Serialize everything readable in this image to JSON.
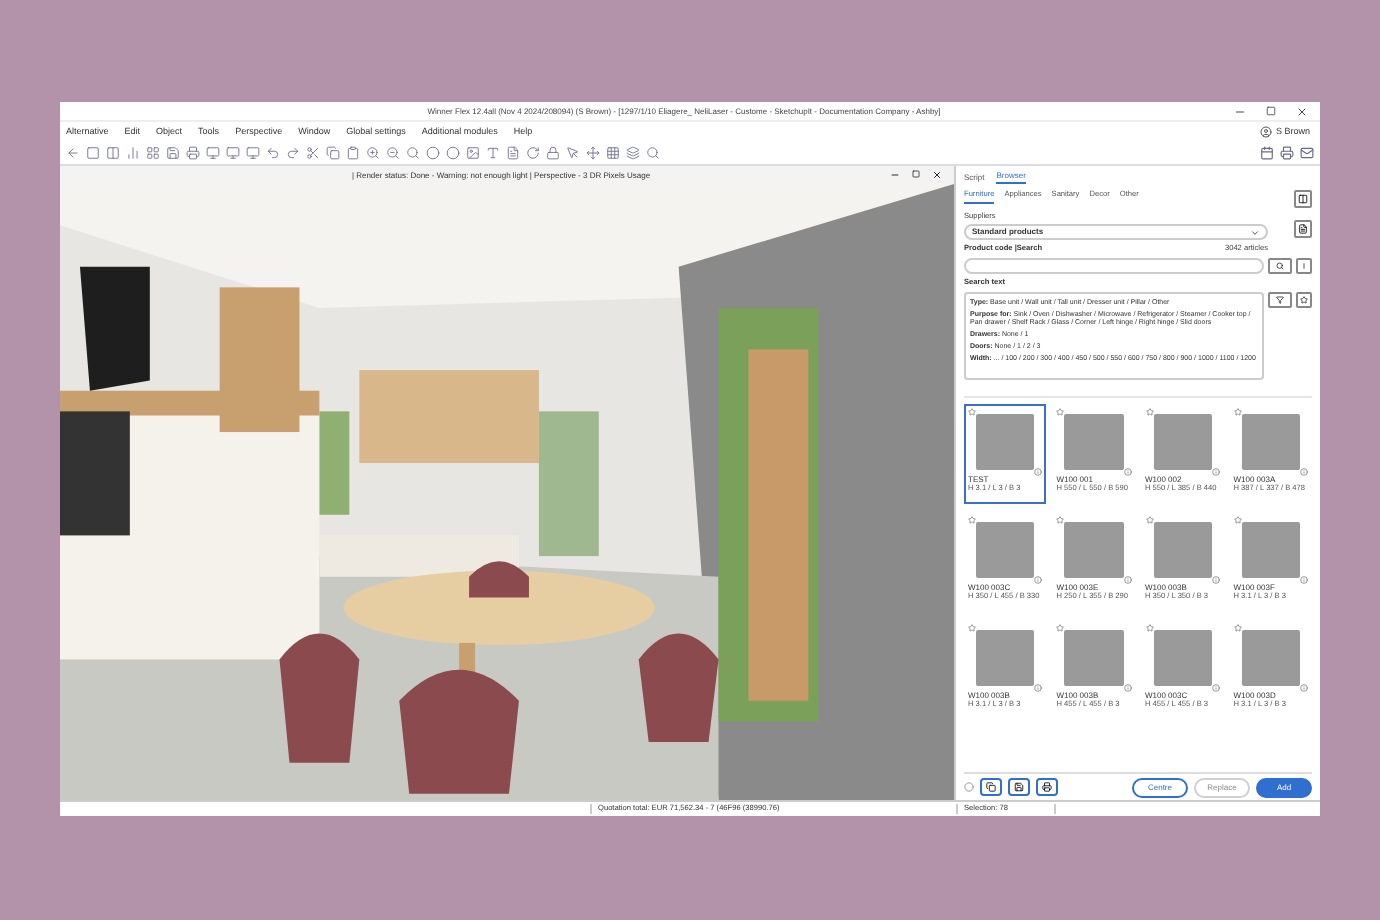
{
  "window": {
    "title": "Winner Flex 12.4all (Nov 4 2024/208094) (S Brown) - [1297/1/10 Eliagere_ NeliLaser - Custome - SketchupIt - Documentation Company - Ashby]"
  },
  "menu": [
    "Alternative",
    "Edit",
    "Object",
    "Tools",
    "Perspective",
    "Window",
    "Global settings",
    "Additional modules",
    "Help"
  ],
  "user": "S Brown",
  "viewport": {
    "status": "| Render status: Done - Warning: not enough light | Perspective - 3 DR Pixels Usage"
  },
  "panel": {
    "tabs": [
      {
        "label": "Script",
        "selected": false
      },
      {
        "label": "Browser",
        "selected": true
      }
    ],
    "subtabs": [
      {
        "label": "Furniture",
        "selected": true
      },
      {
        "label": "Appliances",
        "selected": false
      },
      {
        "label": "Sanitary",
        "selected": false
      },
      {
        "label": "Decor",
        "selected": false
      },
      {
        "label": "Other",
        "selected": false
      }
    ],
    "supplier_label": "Suppliers",
    "supplier": "Standard products",
    "code_label": "Product code |Search",
    "count": "3042 articles",
    "search_label": "Search text",
    "filters": [
      "**Type:** Base unit / Wall unit / Tall unit / Dresser unit / Pillar / Other",
      "**Purpose for:** Sink / Oven / Dishwasher / Microwave / Refrigerator / Steamer / Cooker top / Pan drawer / Shelf Rack / Glass / Corner / Left hinge / Right hinge / Slid doors",
      "**Drawers:** None / 1",
      "**Doors:** None / 1 / 2 / 3",
      "**Width:** ... / 100 / 200 / 300 / 400 / 450 / 500 / 550 / 600 / 750 / 800 / 900 / 1000 / 1100 / 1200"
    ],
    "products": [
      {
        "code": "TEST",
        "dims": "H 3.1 / L 3 / B 3",
        "selected": true
      },
      {
        "code": "W100 001",
        "dims": "H 550 / L 550 / B 590",
        "selected": false
      },
      {
        "code": "W100 002",
        "dims": "H 550 / L 385 / B 440",
        "selected": false
      },
      {
        "code": "W100 003A",
        "dims": "H 387 / L 337 / B 478",
        "selected": false
      },
      {
        "code": "W100 003C",
        "dims": "H 350 / L 455 / B 330",
        "selected": false
      },
      {
        "code": "W100 003E",
        "dims": "H 250 / L 355 / B 290",
        "selected": false
      },
      {
        "code": "W100 003B",
        "dims": "H 350 / L 350 / B 3",
        "selected": false
      },
      {
        "code": "W100 003F",
        "dims": "H 3.1 / L 3 / B 3",
        "selected": false
      },
      {
        "code": "W100 003B",
        "dims": "H 3.1 / L 3 / B 3",
        "selected": false
      },
      {
        "code": "W100 003B",
        "dims": "H 455 / L 455 / B 3",
        "selected": false
      },
      {
        "code": "W100 003C",
        "dims": "H 455 / L 455 / B 3",
        "selected": false
      },
      {
        "code": "W100 003D",
        "dims": "H 3.1 / L 3 / B 3",
        "selected": false
      }
    ],
    "buttons": [
      {
        "label": "Centre",
        "disabled": false,
        "primary": false
      },
      {
        "label": "Replace",
        "disabled": true,
        "primary": false
      },
      {
        "label": "Add",
        "disabled": false,
        "primary": true
      }
    ]
  },
  "status_bar": {
    "total": "Quotation total: EUR 71,562.34 - 7 (46F96 (38990.76)",
    "selection": "Selection: 78"
  }
}
